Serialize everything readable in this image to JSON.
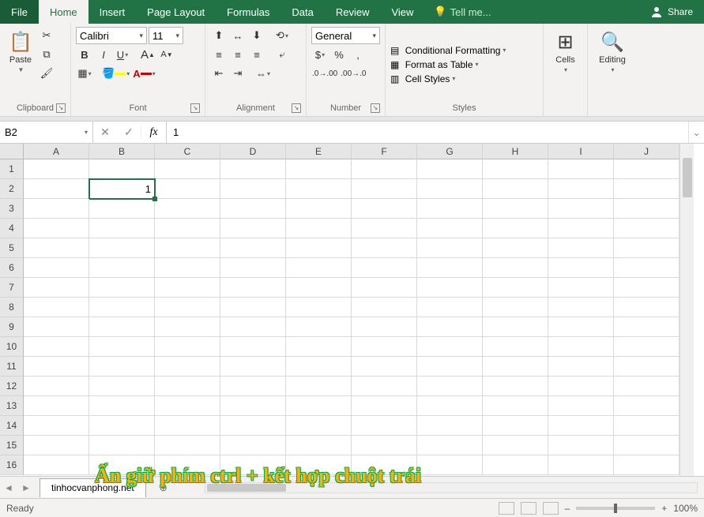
{
  "tabs": {
    "file": "File",
    "home": "Home",
    "insert": "Insert",
    "pagelayout": "Page Layout",
    "formulas": "Formulas",
    "data": "Data",
    "review": "Review",
    "view": "View",
    "tellme": "Tell me...",
    "share": "Share"
  },
  "ribbon": {
    "clipboard": {
      "label": "Clipboard",
      "paste": "Paste"
    },
    "font": {
      "label": "Font",
      "name": "Calibri",
      "size": "11",
      "bold": "B",
      "italic": "I",
      "underline": "U",
      "increase": "A",
      "decrease": "A"
    },
    "alignment": {
      "label": "Alignment"
    },
    "number": {
      "label": "Number",
      "format": "General",
      "currency": "$",
      "percent": "%",
      "comma": ","
    },
    "styles": {
      "label": "Styles",
      "cond": "Conditional Formatting",
      "table": "Format as Table",
      "cell": "Cell Styles"
    },
    "cells": {
      "label": "Cells"
    },
    "editing": {
      "label": "Editing"
    }
  },
  "fbar": {
    "namebox": "B2",
    "formula": "1"
  },
  "grid": {
    "cols": [
      "A",
      "B",
      "C",
      "D",
      "E",
      "F",
      "G",
      "H",
      "I",
      "J"
    ],
    "rows": [
      "1",
      "2",
      "3",
      "4",
      "5",
      "6",
      "7",
      "8",
      "9",
      "10",
      "11",
      "12",
      "13",
      "14",
      "15",
      "16"
    ],
    "b2": "1"
  },
  "sheet_tab": "tinhocvanphong.net",
  "status": {
    "ready": "Ready",
    "zoom": "100%",
    "plus": "+",
    "minus": "–"
  },
  "overlay": "Ấn giữ phím ctrl + kết hợp chuột trái"
}
